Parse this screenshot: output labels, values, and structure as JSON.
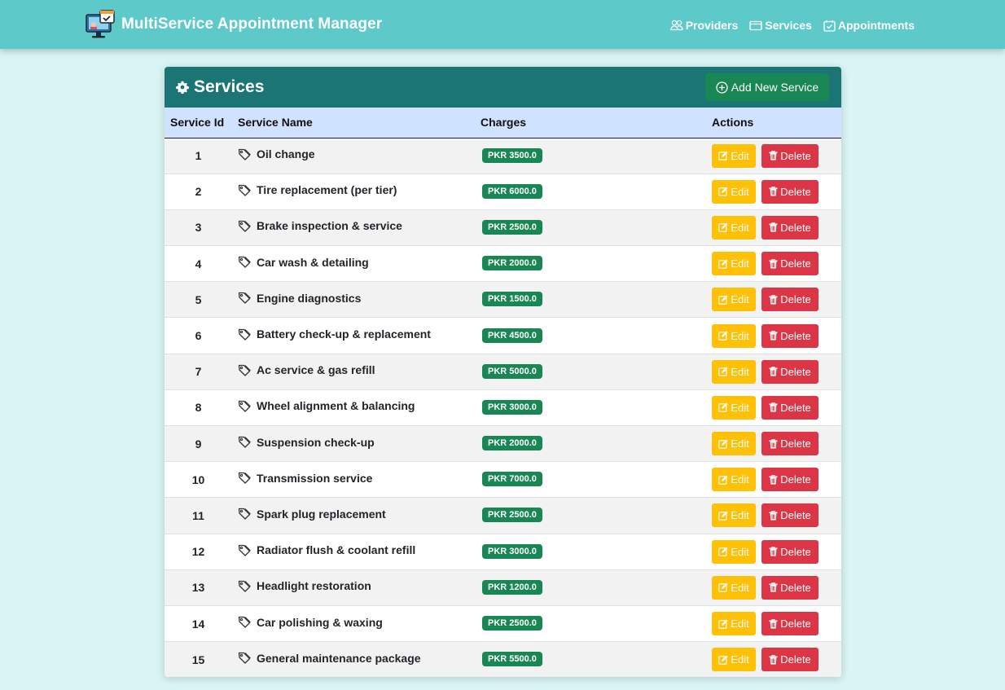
{
  "app": {
    "title": "MultiService Appointment Manager",
    "logo_icon": "computer-calendar-icon"
  },
  "nav": {
    "items": [
      {
        "label": "Providers",
        "icon": "people-icon"
      },
      {
        "label": "Services",
        "icon": "envelope-icon"
      },
      {
        "label": "Appointments",
        "icon": "calendar-check-icon"
      }
    ]
  },
  "card": {
    "title": "Services",
    "title_icon": "gear-icon",
    "add_button": "Add New Service"
  },
  "table": {
    "headers": [
      "Service Id",
      "Service Name",
      "Charges",
      "Actions"
    ],
    "edit_label": "Edit",
    "delete_label": "Delete",
    "rows": [
      {
        "id": "1",
        "name": "Oil change",
        "charges": "PKR 3500.0"
      },
      {
        "id": "2",
        "name": "Tire replacement (per tier)",
        "charges": "PKR 6000.0"
      },
      {
        "id": "3",
        "name": "Brake inspection & service",
        "charges": "PKR 2500.0"
      },
      {
        "id": "4",
        "name": "Car wash & detailing",
        "charges": "PKR 2000.0"
      },
      {
        "id": "5",
        "name": "Engine diagnostics",
        "charges": "PKR 1500.0"
      },
      {
        "id": "6",
        "name": "Battery check-up & replacement",
        "charges": "PKR 4500.0"
      },
      {
        "id": "7",
        "name": "Ac service & gas refill",
        "charges": "PKR 5000.0"
      },
      {
        "id": "8",
        "name": "Wheel alignment & balancing",
        "charges": "PKR 3000.0"
      },
      {
        "id": "9",
        "name": "Suspension check-up",
        "charges": "PKR 2000.0"
      },
      {
        "id": "10",
        "name": "Transmission service",
        "charges": "PKR 7000.0"
      },
      {
        "id": "11",
        "name": "Spark plug replacement",
        "charges": "PKR 2500.0"
      },
      {
        "id": "12",
        "name": "Radiator flush & coolant refill",
        "charges": "PKR 3000.0"
      },
      {
        "id": "13",
        "name": "Headlight restoration",
        "charges": "PKR 1200.0"
      },
      {
        "id": "14",
        "name": "Car polishing & waxing",
        "charges": "PKR 2500.0"
      },
      {
        "id": "15",
        "name": "General maintenance package",
        "charges": "PKR 5500.0"
      }
    ]
  },
  "colors": {
    "navbar": "#5ec9c9",
    "background": "#d9f4f4",
    "card_header": "#1b7574",
    "table_header": "#cfe2ff",
    "success": "#198754",
    "warning": "#ffc107",
    "danger": "#dc3545"
  }
}
